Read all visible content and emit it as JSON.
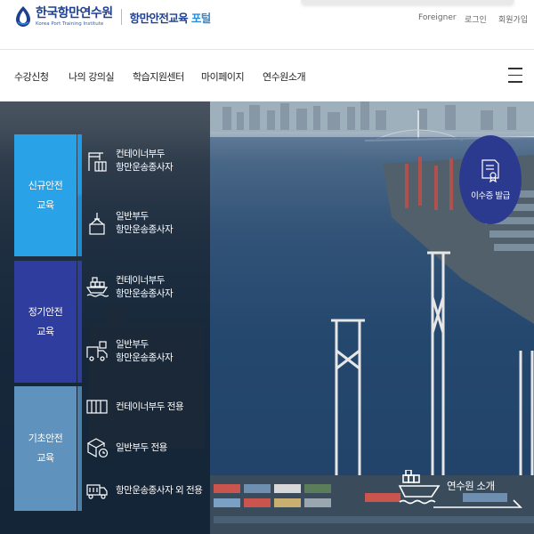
{
  "header": {
    "logo_ko": "한국항만연수원",
    "logo_en": "Korea Port Training Institute",
    "portal_main": "항만안전교육",
    "portal_accent": "포털",
    "util_links": [
      "Foreigner",
      "로그인",
      "회원가입"
    ]
  },
  "gnb": {
    "items": [
      "수강신청",
      "나의 강의실",
      "학습지원센터",
      "마이페이지",
      "연수원소개"
    ],
    "menu_icon": "hamburger-icon"
  },
  "hero": {
    "categories": [
      {
        "line1": "신규안전",
        "line2": "교육"
      },
      {
        "line1": "정기안전",
        "line2": "교육"
      },
      {
        "line1": "기초안전",
        "line2": "교육"
      }
    ],
    "courses": [
      {
        "icon": "container-crane-icon",
        "line1": "컨테이너부두",
        "line2": "항만운송종사자"
      },
      {
        "icon": "cargo-hook-icon",
        "line1": "일반부두",
        "line2": "항만운송종사자"
      },
      {
        "icon": "container-ship-icon",
        "line1": "컨테이너부두",
        "line2": "항만운송종사자"
      },
      {
        "icon": "cargo-truck-icon",
        "line1": "일반부두",
        "line2": "항만운송종사자"
      },
      {
        "icon": "container-icon",
        "line1": "컨테이너부두 전용",
        "line2": ""
      },
      {
        "icon": "box-clock-icon",
        "line1": "일반부두 전용",
        "line2": ""
      },
      {
        "icon": "truck-icon",
        "line1": "항만운송종사자 외 전용",
        "line2": ""
      }
    ],
    "certificate_label": "이수증 발급",
    "certificate_icon": "certificate-icon",
    "intro_label": "연수원 소개",
    "intro_icon": "ship-icon"
  },
  "colors": {
    "brand_navy": "#1f3f8f",
    "brand_blue": "#2f8cd9",
    "cat_new": "#2aa2e8",
    "cat_regular": "#2f3d9e",
    "cat_basic": "#5f93bd"
  }
}
